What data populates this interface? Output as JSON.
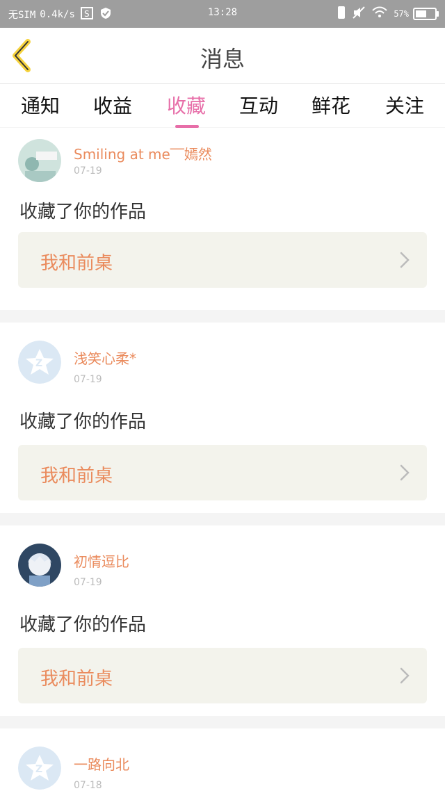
{
  "status_bar": {
    "carrier": "无SIM",
    "speed": "0.4k/s",
    "time": "13:28",
    "battery_percent": "57%",
    "battery_level": 0.57
  },
  "header": {
    "title": "消息",
    "back_icon": "chevron-left-icon"
  },
  "tabs": [
    {
      "label": "通知",
      "active": false
    },
    {
      "label": "收益",
      "active": false
    },
    {
      "label": "收藏",
      "active": true
    },
    {
      "label": "互动",
      "active": false
    },
    {
      "label": "鲜花",
      "active": false
    },
    {
      "label": "关注",
      "active": false
    }
  ],
  "colors": {
    "accent_pink": "#e76ea8",
    "accent_orange": "#ea8b5d",
    "back_icon_yellow": "#f6d33e"
  },
  "notifications": [
    {
      "username": "Smiling at me‾‾嫣然",
      "date": "07-19",
      "action": "收藏了你的作品",
      "work_title": "我和前桌",
      "avatar": "photo-avatar"
    },
    {
      "username": "浅笑心柔*",
      "date": "07-19",
      "action": "收藏了你的作品",
      "work_title": "我和前桌",
      "avatar": "default-avatar-icon"
    },
    {
      "username": "初情逗比",
      "date": "07-19",
      "action": "收藏了你的作品",
      "work_title": "我和前桌",
      "avatar": "anime-avatar"
    },
    {
      "username": "一路向北",
      "date": "07-18",
      "action": "",
      "work_title": "",
      "avatar": "default-avatar-icon"
    }
  ]
}
